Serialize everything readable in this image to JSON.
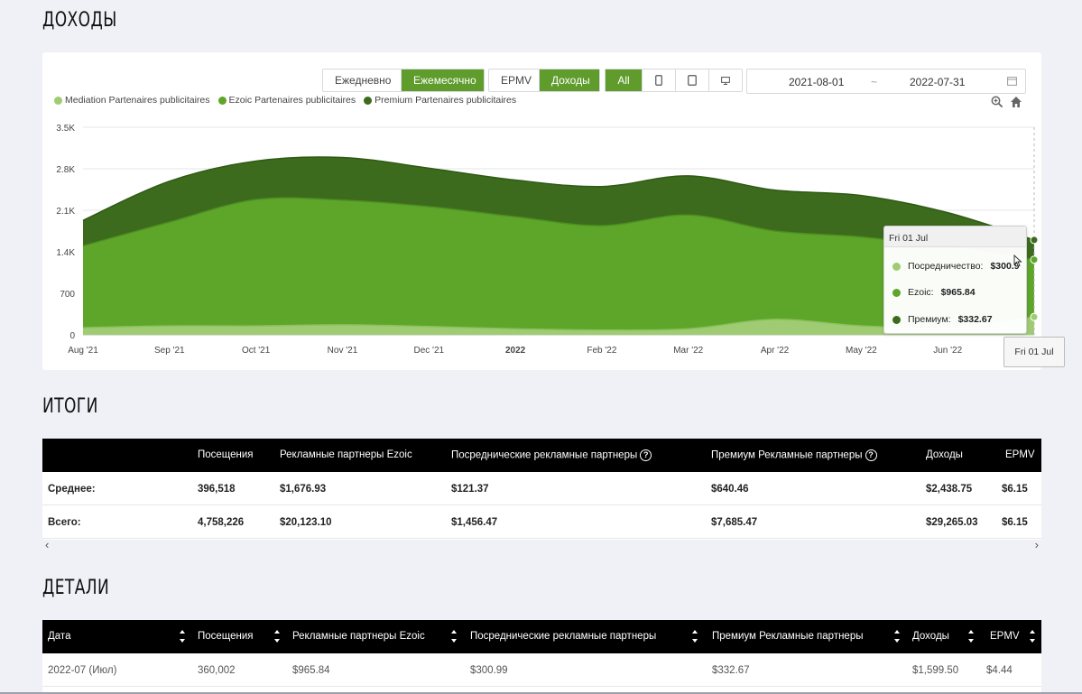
{
  "titles": {
    "revenue": "ДОХОДЫ",
    "totals": "ИТОГИ",
    "details": "ДЕТАЛИ"
  },
  "toolbar": {
    "period": [
      {
        "label": "Ежедневно",
        "active": false
      },
      {
        "label": "Ежемесячно",
        "active": true
      }
    ],
    "metric": [
      {
        "label": "EPMV",
        "active": false
      },
      {
        "label": "Доходы",
        "active": true
      }
    ],
    "device": [
      {
        "label": "All",
        "active": true
      }
    ],
    "device_icons": [
      "mobile-icon",
      "tablet-icon",
      "desktop-icon"
    ],
    "date_from": "2021-08-01",
    "date_sep": "~",
    "date_to": "2022-07-31"
  },
  "colors": {
    "mediation": "#9fcc73",
    "ezoic": "#5ea62a",
    "premium": "#3d6b1d",
    "accent": "#5f9c2c"
  },
  "chart_data": {
    "type": "area",
    "stacked": true,
    "categories": [
      "Aug '21",
      "Sep '21",
      "Oct '21",
      "Nov '21",
      "Dec '21",
      "2022",
      "Feb '22",
      "Mar '22",
      "Apr '22",
      "May '22",
      "Jun '22",
      "Fri 01 Jul"
    ],
    "x_ticks": [
      "Aug '21",
      "Sep '21",
      "Oct '21",
      "Nov '21",
      "Dec '21",
      "2022",
      "Feb '22",
      "Mar '22",
      "Apr '22",
      "May '22",
      "Jun '22"
    ],
    "y_ticks": [
      "0",
      "700",
      "1.4K",
      "2.1K",
      "2.8K",
      "3.5K"
    ],
    "ylim": [
      0,
      3500
    ],
    "series": [
      {
        "name": "Mediation Partenaires publicitaires",
        "values": [
          120,
          150,
          150,
          170,
          140,
          100,
          80,
          100,
          260,
          150,
          130,
          300.99
        ]
      },
      {
        "name": "Ezoic Partenaires publicitaires",
        "values": [
          1380,
          1750,
          2130,
          2100,
          2020,
          1890,
          1760,
          1920,
          1490,
          1500,
          1350,
          965.84
        ]
      },
      {
        "name": "Premium Partenaires publicitaires",
        "values": [
          430,
          690,
          650,
          720,
          650,
          620,
          660,
          660,
          690,
          700,
          580,
          332.67
        ]
      }
    ],
    "grid": true,
    "legend": "top-left"
  },
  "tooltip": {
    "title": "Fri 01 Jul",
    "rows": [
      {
        "label": "Посредничество:",
        "value": "$300.9"
      },
      {
        "label": "Ezoic:",
        "value": "$965.84"
      },
      {
        "label": "Премиум:",
        "value": "$332.67"
      }
    ],
    "x_label": "Fri 01 Jul"
  },
  "totals": {
    "headers": [
      "Посещения",
      "Рекламные партнеры Ezoic",
      "Посреднические рекламные партнеры",
      "Премиум Рекламные партнеры",
      "Доходы",
      "EPMV"
    ],
    "rows": [
      {
        "label": "Среднее:",
        "cells": [
          "396,518",
          "$1,676.93",
          "$121.37",
          "$640.46",
          "$2,438.75",
          "$6.15"
        ]
      },
      {
        "label": "Всего:",
        "cells": [
          "4,758,226",
          "$20,123.10",
          "$1,456.47",
          "$7,685.47",
          "$29,265.03",
          "$6.15"
        ]
      }
    ],
    "scroll_left": "‹",
    "scroll_right": "›"
  },
  "details": {
    "headers": [
      "Дата",
      "Посещения",
      "Рекламные партнеры Ezoic",
      "Посреднические рекламные партнеры",
      "Премиум Рекламные партнеры",
      "Доходы",
      "EPMV"
    ],
    "rows": [
      {
        "cells": [
          "2022-07 (Июл)",
          "360,002",
          "$965.84",
          "$300.99",
          "$332.67",
          "$1,599.50",
          "$4.44"
        ]
      }
    ]
  }
}
